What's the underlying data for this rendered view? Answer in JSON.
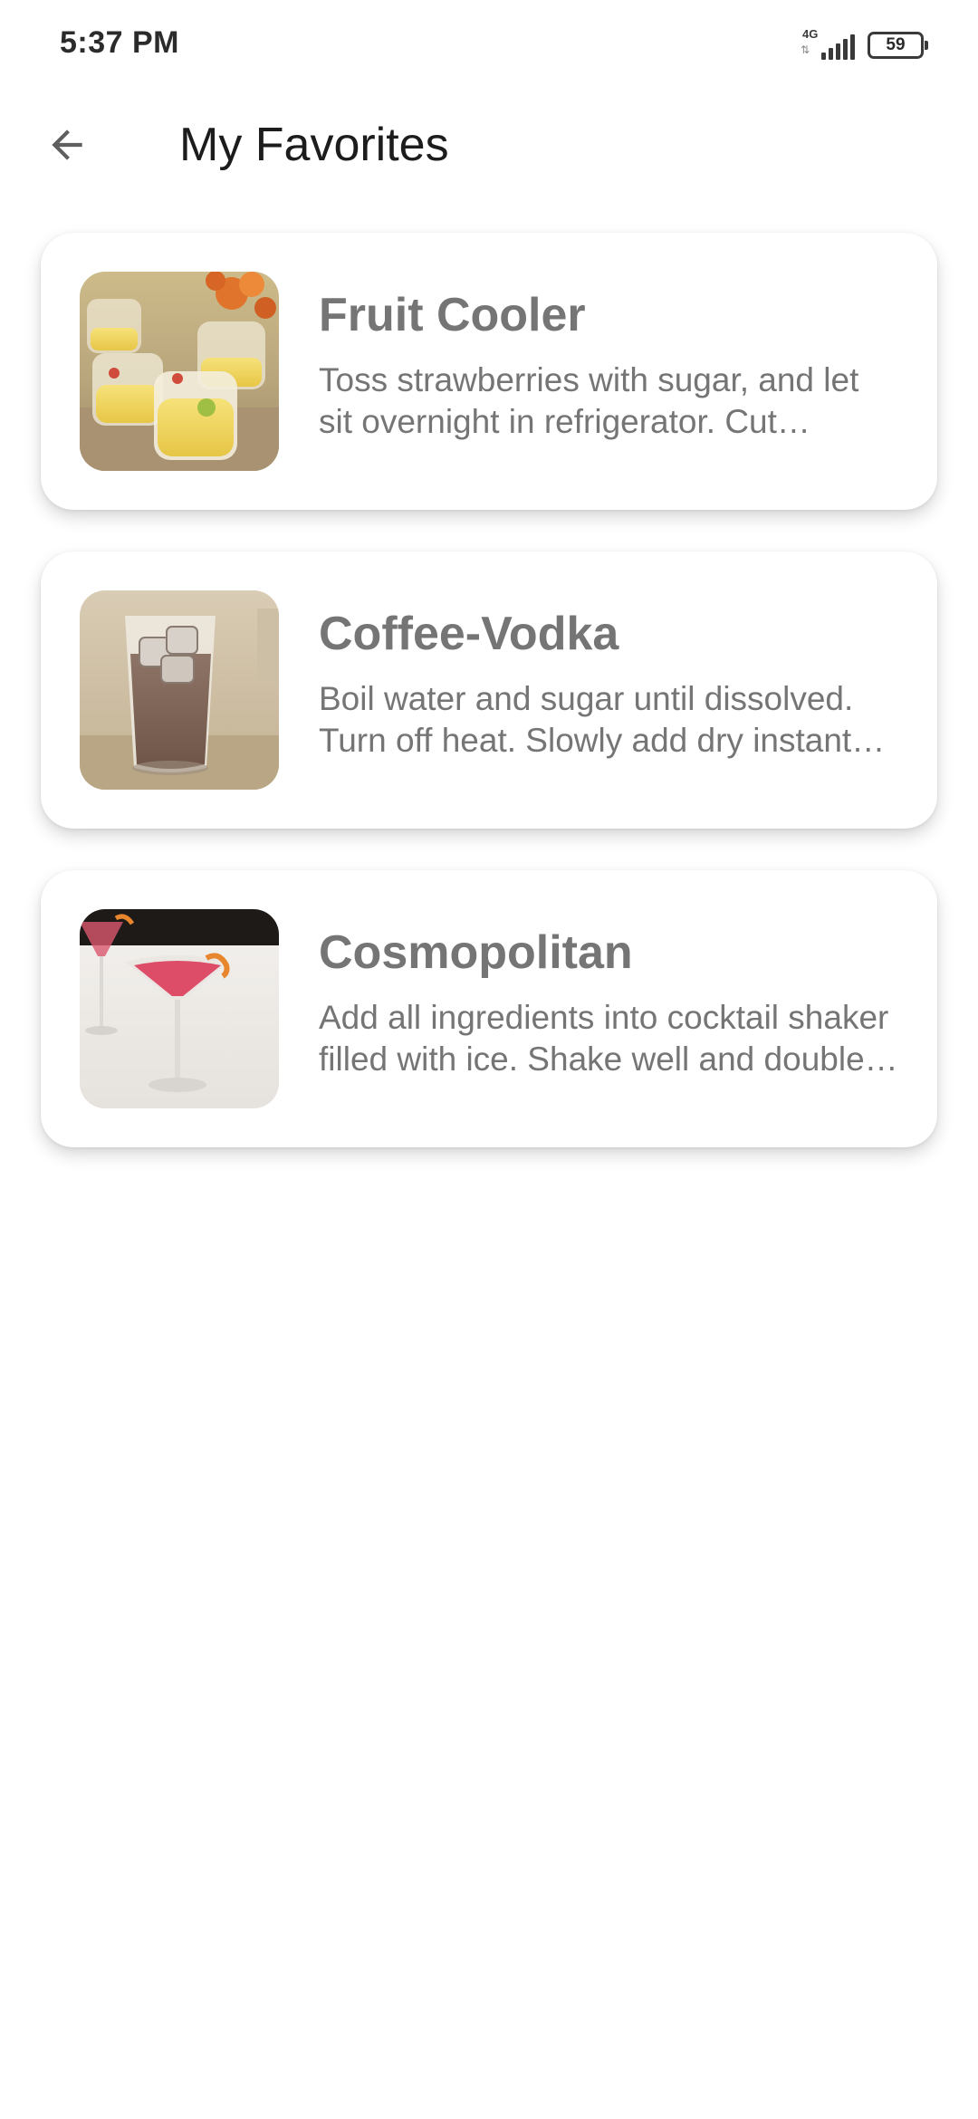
{
  "status_bar": {
    "time": "5:37 PM",
    "network_type": "4G",
    "network_arrows": "⇅",
    "battery_level": "59"
  },
  "app_bar": {
    "back_icon": "arrow-back-icon",
    "title": "My Favorites"
  },
  "favorites": [
    {
      "title": "Fruit Cooler",
      "description": "Toss strawberries with sugar, and let sit overnight in refrigerator. Cut lemons, reserve juice, and combine with strawberries.",
      "image": "fruit-cooler-photo"
    },
    {
      "title": "Coffee-Vodka",
      "description": "Boil water and sugar until dissolved. Turn off heat. Slowly add dry instant coffee and continue stirring.",
      "image": "coffee-vodka-photo"
    },
    {
      "title": "Cosmopolitan",
      "description": "Add all ingredients into cocktail shaker filled with ice. Shake well and double strain into large cocktail glass.",
      "image": "cosmopolitan-photo"
    }
  ]
}
